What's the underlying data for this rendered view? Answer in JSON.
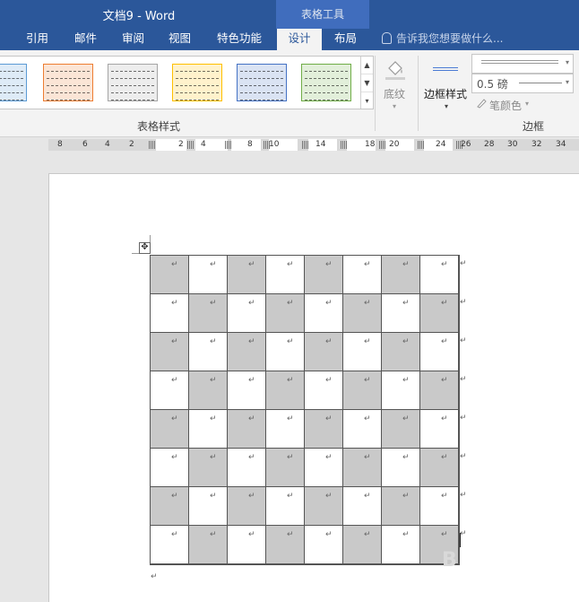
{
  "window": {
    "title": "文档9 - Word",
    "context_header": "表格工具"
  },
  "tabs": [
    {
      "label": "引用",
      "active": false
    },
    {
      "label": "邮件",
      "active": false
    },
    {
      "label": "审阅",
      "active": false
    },
    {
      "label": "视图",
      "active": false
    },
    {
      "label": "特色功能",
      "active": false
    },
    {
      "label": "设计",
      "active": true
    },
    {
      "label": "布局",
      "active": false
    }
  ],
  "tellme": {
    "placeholder": "告诉我您想要做什么..."
  },
  "ribbon": {
    "table_styles_label": "表格样式",
    "shading_label": "底纹",
    "border_styles_label": "边框样式",
    "pen_weight": "0.5 磅",
    "pen_color": "笔颜色",
    "borders_group_label": "边框",
    "swatch_colors": [
      "#5b9bd5",
      "#ed7d31",
      "#a5a5a5",
      "#ffc000",
      "#4472c4",
      "#70ad47"
    ]
  },
  "ruler": {
    "labels": [
      "8",
      "6",
      "4",
      "2",
      "2",
      "4",
      "8",
      "10",
      "14",
      "18",
      "20",
      "24",
      "26",
      "28",
      "30",
      "32",
      "34"
    ]
  },
  "document": {
    "paragraph_mark": "↵",
    "cell_mark": "↵",
    "rows": 8,
    "cols": 8,
    "shading": "checkerboard",
    "shade_color": "#c9c9c9"
  },
  "watermark": "B"
}
